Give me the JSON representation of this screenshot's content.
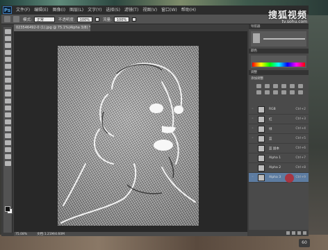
{
  "menu": {
    "logo": "Ps",
    "items": [
      "文件(F)",
      "编辑(E)",
      "图像(I)",
      "图层(L)",
      "文字(Y)",
      "选择(S)",
      "滤镜(T)",
      "视图(V)",
      "窗口(W)",
      "帮助(H)"
    ]
  },
  "options": {
    "mode_label": "模式:",
    "mode_value": "正常",
    "opacity_label": "不透明度:",
    "opacity_value": "100%",
    "flow_label": "流量:",
    "flow_value": "100%"
  },
  "document": {
    "tab_title": "023546492-0 (1).jpg @ 75.1%(Alpha 3/8) *"
  },
  "status": {
    "zoom": "75.08%",
    "doc_size": "文档:1.21M/4.60M"
  },
  "panels": {
    "navigator_head": "导航器",
    "color_head": "颜色",
    "adjust_head": "调整",
    "adjust_label": "添加调整"
  },
  "channels": [
    {
      "name": "RGB",
      "key": "Ctrl+2"
    },
    {
      "name": "红",
      "key": "Ctrl+3"
    },
    {
      "name": "绿",
      "key": "Ctrl+4"
    },
    {
      "name": "蓝",
      "key": "Ctrl+5"
    },
    {
      "name": "蓝 副本",
      "key": "Ctrl+6"
    },
    {
      "name": "Alpha 1",
      "key": "Ctrl+7"
    },
    {
      "name": "Alpha 2",
      "key": "Ctrl+8"
    },
    {
      "name": "Alpha 3",
      "key": "Ctrl+9"
    }
  ],
  "watermark": {
    "title": "搜狐视频",
    "url": "tv.sohu.com"
  },
  "corner_logo": "60"
}
